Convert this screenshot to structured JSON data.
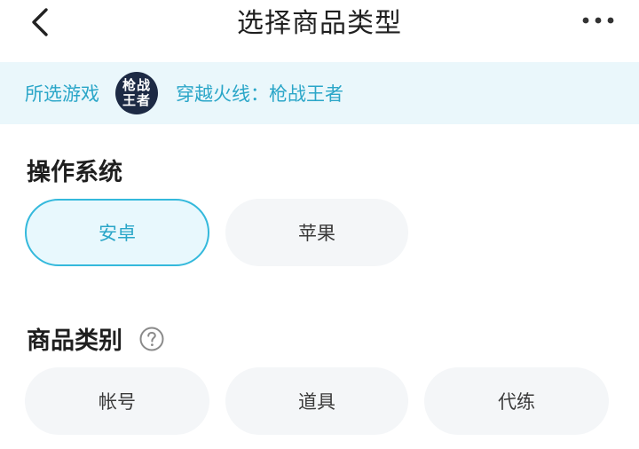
{
  "header": {
    "title": "选择商品类型",
    "back_icon": "chevron-left-icon",
    "more_icon": "more-horizontal-icon"
  },
  "selected_game": {
    "label": "所选游戏",
    "logo_text_line1": "枪战",
    "logo_text_line2": "王者",
    "name": "穿越火线：枪战王者"
  },
  "os_section": {
    "title": "操作系统",
    "options": [
      {
        "label": "安卓",
        "selected": true
      },
      {
        "label": "苹果",
        "selected": false
      }
    ]
  },
  "category_section": {
    "title": "商品类别",
    "help_icon": "question-circle-icon",
    "options": [
      {
        "label": "帐号",
        "selected": false
      },
      {
        "label": "道具",
        "selected": false
      },
      {
        "label": "代练",
        "selected": false
      }
    ]
  },
  "colors": {
    "accent": "#2aa6c8",
    "banner_bg": "#eaf7fb",
    "chip_bg": "#f4f6f8",
    "selected_border": "#34b9dc",
    "selected_bg": "#e8f8fd"
  }
}
